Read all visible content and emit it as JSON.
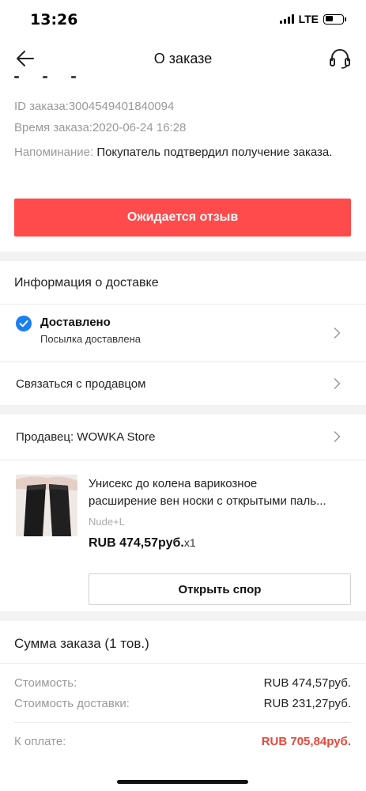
{
  "status_bar": {
    "time": "13:26",
    "network": "LTE"
  },
  "header": {
    "title": "О заказе"
  },
  "order": {
    "id_line": "ID заказа:3004549401840094",
    "time_line": "Время заказа:2020-06-24 16:28",
    "reminder_label": "Напоминание:",
    "reminder_text": "Покупатель подтвердил получение заказа.",
    "review_button": "Ожидается отзыв"
  },
  "delivery": {
    "section_title": "Информация о доставке",
    "status_title": "Доставлено",
    "status_sub": "Посылка доставлена",
    "contact_seller": "Связаться с продавцом"
  },
  "seller": {
    "label": "Продавец: WOWKA Store"
  },
  "product": {
    "title_line1": "Унисекс до колена варикозное",
    "title_line2": "расширение вен носки с открытыми паль...",
    "variant": "Nude+L",
    "price": "RUB 474,57руб.",
    "qty": "x1",
    "dispute_button": "Открыть спор"
  },
  "summary": {
    "title": "Сумма заказа (1 тов.)",
    "cost_label": "Стоимость:",
    "cost_value": "RUB 474,57руб.",
    "shipping_label": "Стоимость доставки:",
    "shipping_value": "RUB 231,27руб.",
    "total_label": "К оплате:",
    "total_value": "RUB 705,84руб."
  },
  "colors": {
    "accent": "#ff4b4b",
    "total_red": "#e5483a",
    "check_blue": "#1a7ff0",
    "gap_gray": "#f2f2f2"
  }
}
